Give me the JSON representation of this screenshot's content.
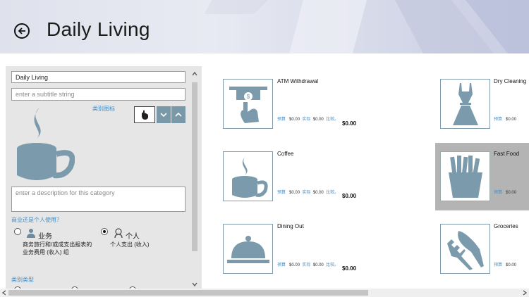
{
  "header": {
    "title": "Daily Living"
  },
  "form": {
    "title_value": "Daily Living",
    "subtitle_placeholder": "enter a subtitle string",
    "icon_label": "类别图标",
    "description_placeholder": "enter a description for this category",
    "usage_question": "商业还是个人使用？",
    "business_label": "业务",
    "business_desc": "商务旅行和/或成支出报表的业务费用 (收入) 组",
    "personal_label": "个人",
    "personal_desc": "个人支出 (收入)",
    "category_type_label": "类别类型"
  },
  "tile_labels": {
    "budget": "预算",
    "amount": "$0.00",
    "actual": "实际",
    "compare": "比较。"
  },
  "tiles": [
    {
      "name": "ATM Withdrawal",
      "icon": "atm-icon",
      "total": "$0.00"
    },
    {
      "name": "Coffee",
      "icon": "coffee-icon",
      "total": "$0.00"
    },
    {
      "name": "Dining Out",
      "icon": "cloche-icon",
      "total": "$0.00"
    },
    {
      "name": "Dry Cleaning",
      "icon": "dress-icon",
      "total": ""
    },
    {
      "name": "Fast Food",
      "icon": "fries-icon",
      "total": ""
    },
    {
      "name": "Groceries",
      "icon": "cutlery-icon",
      "total": ""
    }
  ],
  "colors": {
    "accent": "#3f8fc9",
    "icon_fill": "#7b9aab",
    "panel_bg": "#e6e6e6",
    "selected_tile": "#b4b4b4"
  }
}
